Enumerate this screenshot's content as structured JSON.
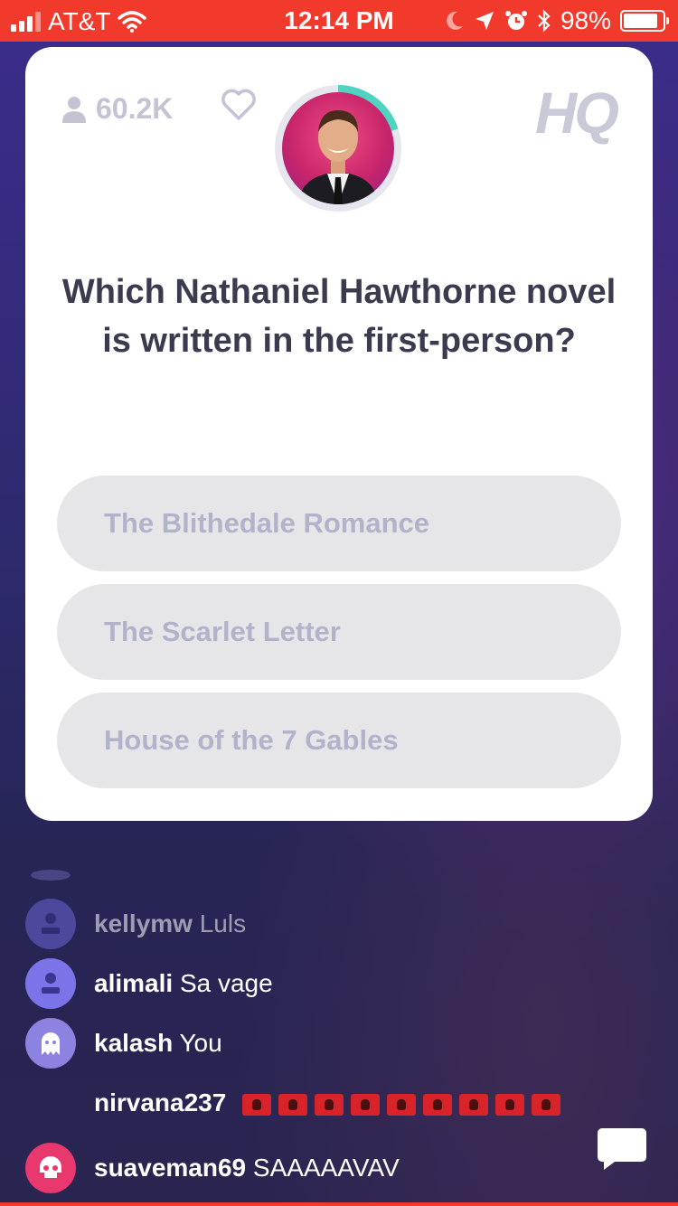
{
  "status_bar": {
    "carrier": "AT&T",
    "time": "12:14 PM",
    "battery_percent": "98%",
    "battery_level": 0.98
  },
  "game": {
    "viewers": "60.2K",
    "logo": "HQ",
    "timer_progress": 0.2,
    "question": "Which Nathaniel Hawthorne novel is written in the first-person?",
    "answers": [
      "The Blithedale Romance",
      "The Scarlet Letter",
      "House of the 7 Gables"
    ]
  },
  "chat": {
    "messages": [
      {
        "user": "kellymw",
        "text": "Luls",
        "avatar": "person-icon",
        "avatar_color": "#6b66d6"
      },
      {
        "user": "alimali",
        "text": "Sa vage",
        "avatar": "person-icon",
        "avatar_color": "#7a74e8"
      },
      {
        "user": "kalash",
        "text": "You",
        "avatar": "ghost-icon",
        "avatar_color": "#8c83e0"
      },
      {
        "user": "nirvana237",
        "text": "",
        "avatar": "",
        "flags": 9
      },
      {
        "user": "suaveman69",
        "text": "SAAAAAVAV",
        "avatar": "skull-icon",
        "avatar_color": "#e8386e"
      }
    ]
  },
  "colors": {
    "status_bar": "#f23a2c",
    "card": "#ffffff",
    "answer_bg": "#e6e6e8",
    "answer_text": "#b0b3ca",
    "timer": "#4fd4c2"
  }
}
